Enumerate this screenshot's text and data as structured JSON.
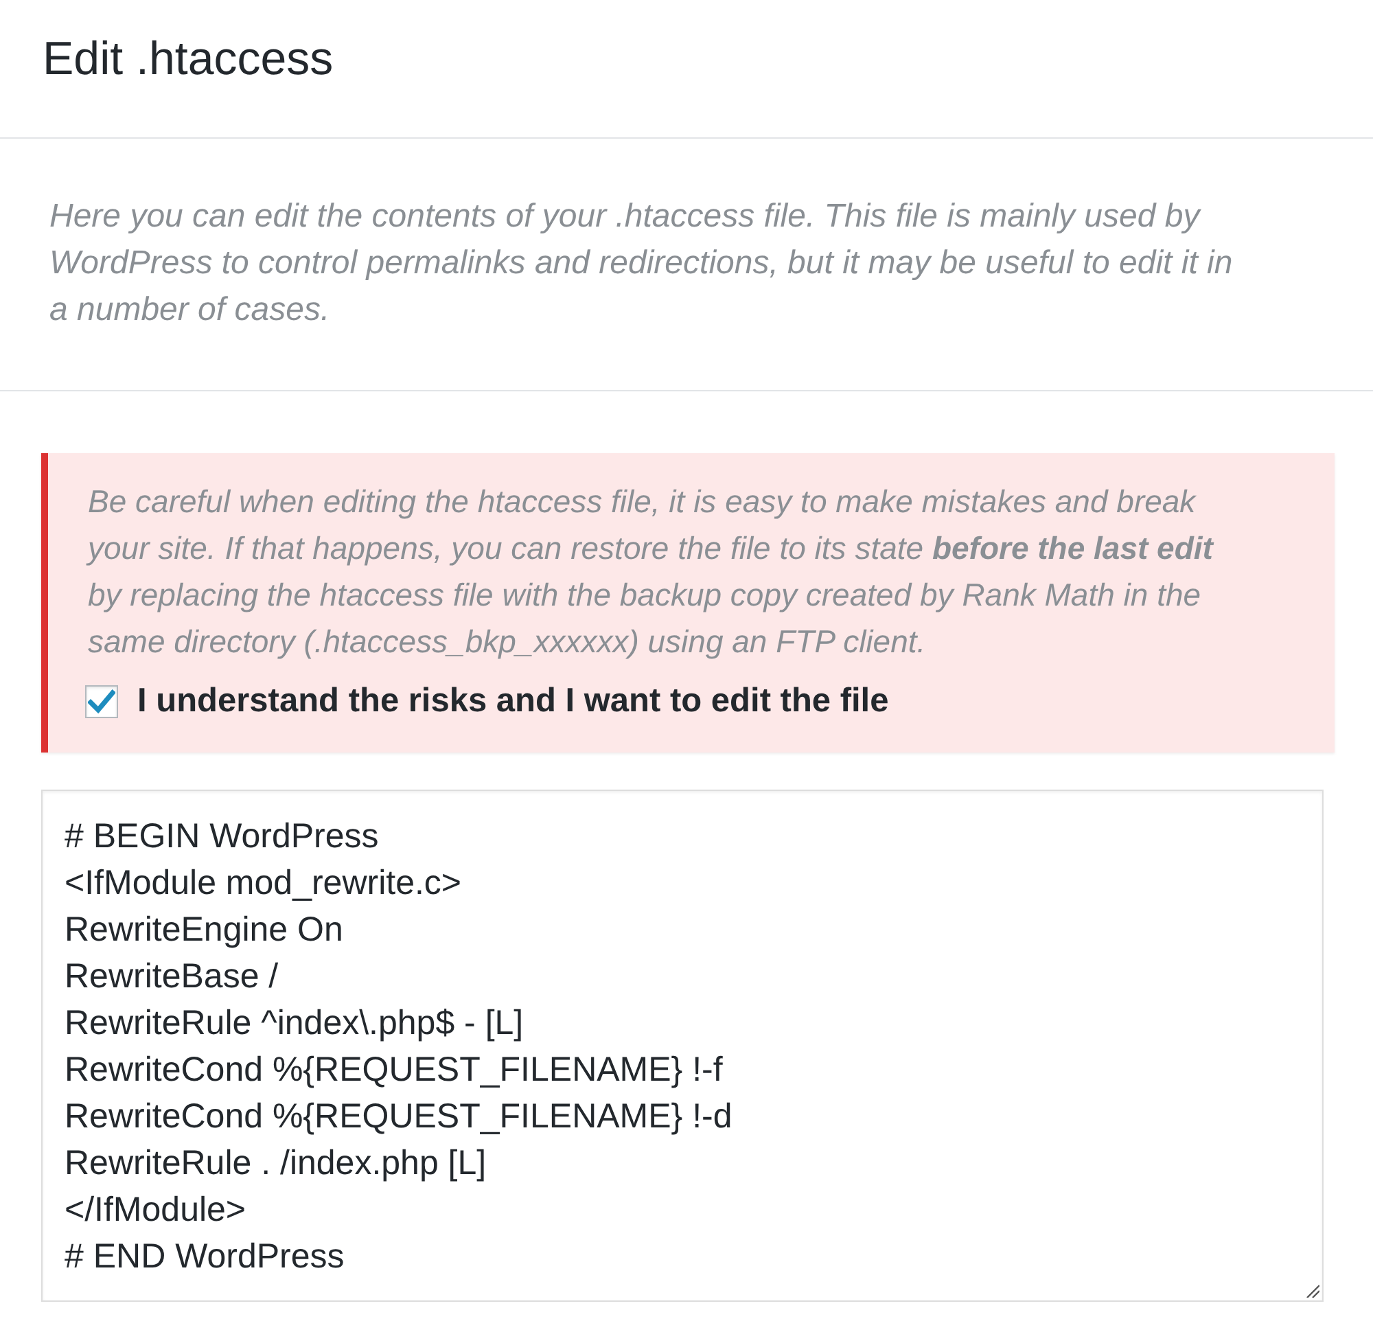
{
  "page": {
    "title": "Edit .htaccess"
  },
  "description": "Here you can edit the contents of your .htaccess file. This file is mainly used by WordPress to control permalinks and redirections, but it may be useful to edit it in a number of cases.",
  "warning": {
    "text": "Be careful when editing the htaccess file, it is easy to make mistakes and break your site. If that happens, you can restore the file to its state **before the last edit** by replacing the htaccess file with the backup copy created by Rank Math in the same directory (.htaccess_bkp_xxxxxx) using an FTP client.",
    "checkbox": {
      "label": "I understand the risks and I want to edit the file",
      "checked": true
    }
  },
  "editor": {
    "lines": [
      "# BEGIN WordPress",
      "<IfModule mod_rewrite.c>",
      "RewriteEngine On",
      "RewriteBase /",
      "RewriteRule ^index\\.php$ - [L]",
      "RewriteCond %{REQUEST_FILENAME} !-f",
      "RewriteCond %{REQUEST_FILENAME} !-d",
      "RewriteRule . /index.php [L]",
      "</IfModule>",
      "# END WordPress"
    ]
  }
}
